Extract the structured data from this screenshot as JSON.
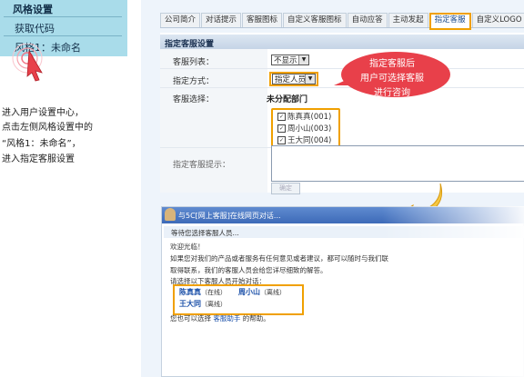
{
  "left_menu": {
    "title": "风格设置",
    "items": [
      "获取代码",
      "风格1：未命名"
    ]
  },
  "instructions": [
    "进入用户设置中心，",
    "点击左侧风格设置中的",
    "“风格1：未命名”，",
    "进入指定客服设置"
  ],
  "tabs": [
    {
      "label": "公司简介",
      "active": false
    },
    {
      "label": "对话提示",
      "active": false
    },
    {
      "label": "客服图标",
      "active": false
    },
    {
      "label": "自定义客服图标",
      "active": false
    },
    {
      "label": "自动应答",
      "active": false
    },
    {
      "label": "主动发起",
      "active": false
    },
    {
      "label": "指定客服",
      "active": true
    },
    {
      "label": "自定义LOGO",
      "active": false
    }
  ],
  "form": {
    "title": "指定客服设置",
    "list_label": "客服列表：",
    "list_value": "不显示",
    "mode_label": "指定方式：",
    "mode_value": "指定人员",
    "select_label": "客服选择：",
    "group_label": "未分配部门",
    "agents": [
      {
        "name": "陈真真(001)",
        "checked": true
      },
      {
        "name": "周小山(003)",
        "checked": true
      },
      {
        "name": "王大同(004)",
        "checked": true
      }
    ],
    "hint_label": "指定客服提示：",
    "confirm_button": "确定"
  },
  "callout": {
    "lines": [
      "指定客服后",
      "用户可选择客服",
      "进行咨询"
    ],
    "color": "#e8404a"
  },
  "chat": {
    "title": "与5C[网上客服]在线网页对话...",
    "subtitle": "等待您选择客服人员...",
    "lines": [
      "欢迎光临！",
      "如果您对我们的产品或者服务有任何意见或者建议，都可以随时与我们联",
      "取得联系，我们的客服人员会给您详尽细致的解答。",
      "请选择以下客服人员开始对话："
    ],
    "agents": [
      {
        "name": "陈真真",
        "status": "（在线）"
      },
      {
        "name": "周小山",
        "status": "（离线）"
      },
      {
        "name": "王大同",
        "status": "（离线）"
      }
    ],
    "footer_prefix": "您也可以选择",
    "footer_link": "客服助手",
    "footer_suffix": "的帮助。"
  },
  "colors": {
    "menu_bg": "#a9dcea",
    "highlight": "#f0a000",
    "callout": "#e8404a",
    "chat_title": "#3d6ab8"
  }
}
